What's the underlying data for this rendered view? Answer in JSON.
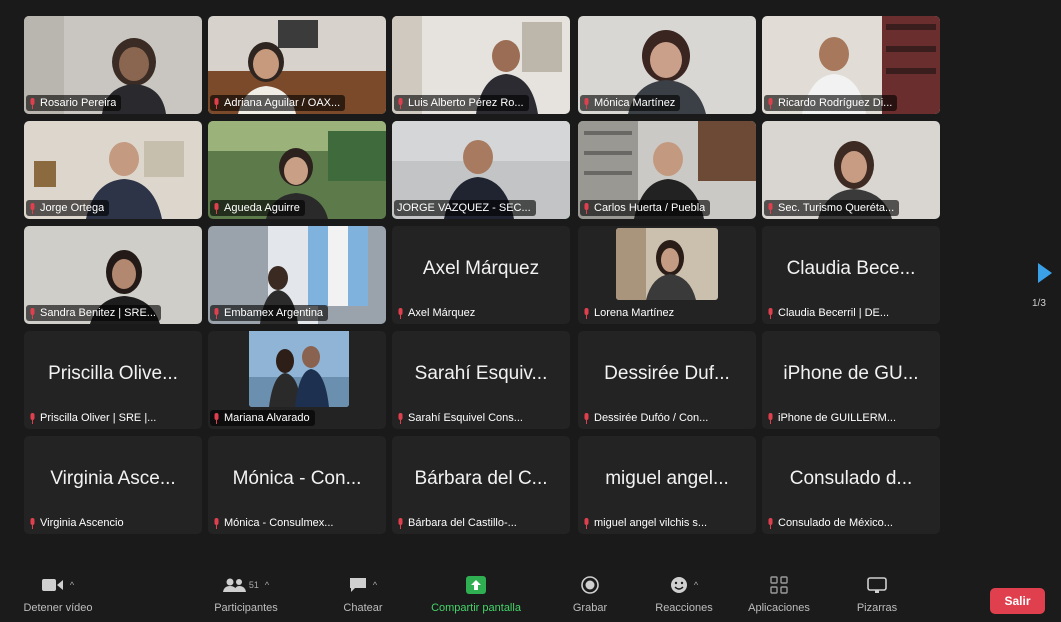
{
  "tiles": [
    {
      "label": "Rosario Pereira"
    },
    {
      "label": "Adriana Aguilar / OAX..."
    },
    {
      "label": "Luis Alberto Pérez Ro..."
    },
    {
      "label": "Mónica Martínez"
    },
    {
      "label": "Ricardo Rodríguez Di..."
    },
    {
      "label": "Jorge Ortega"
    },
    {
      "label": "Agueda Aguirre"
    },
    {
      "label": "JORGE VAZQUEZ - SEC..."
    },
    {
      "label": "Carlos Huerta / Puebla"
    },
    {
      "label": "Sec. Turismo Queréta..."
    },
    {
      "label": "Sandra Benitez | SRE..."
    },
    {
      "label": "Embamex Argentina"
    },
    {
      "label": "Axel Márquez",
      "display": "Axel Márquez"
    },
    {
      "label": "Lorena Martínez"
    },
    {
      "label": "Claudia Becerril | DE...",
      "display": "Claudia Bece..."
    },
    {
      "label": "Priscilla Oliver | SRE |...",
      "display": "Priscilla Olive..."
    },
    {
      "label": "Mariana Alvarado"
    },
    {
      "label": "Sarahí Esquivel Cons...",
      "display": "Sarahí Esquiv..."
    },
    {
      "label": "Dessirée Dufóo / Con...",
      "display": "Dessirée Duf..."
    },
    {
      "label": "iPhone de GUILLERM...",
      "display": "iPhone de GU..."
    },
    {
      "label": "Virginia Ascencio",
      "display": "Virginia Asce..."
    },
    {
      "label": "Mónica - Consulmex...",
      "display": "Mónica - Con..."
    },
    {
      "label": "Bárbara del Castillo-...",
      "display": "Bárbara del C..."
    },
    {
      "label": "miguel angel vilchis s...",
      "display": "miguel angel..."
    },
    {
      "label": "Consulado de México...",
      "display": "Consulado d..."
    }
  ],
  "pager": {
    "text": "1/3"
  },
  "toolbar": {
    "video": "Detener vídeo",
    "participants": "Participantes",
    "participants_count": "51",
    "chat": "Chatear",
    "share": "Compartir pantalla",
    "record": "Grabar",
    "reactions": "Reacciones",
    "apps": "Aplicaciones",
    "whiteboards": "Pizarras",
    "leave": "Salir"
  },
  "colors": {
    "accent_green": "#45d36a",
    "active_border": "#3fbf5a",
    "leave_red": "#e0404e",
    "muted_mic": "#e0404e"
  }
}
